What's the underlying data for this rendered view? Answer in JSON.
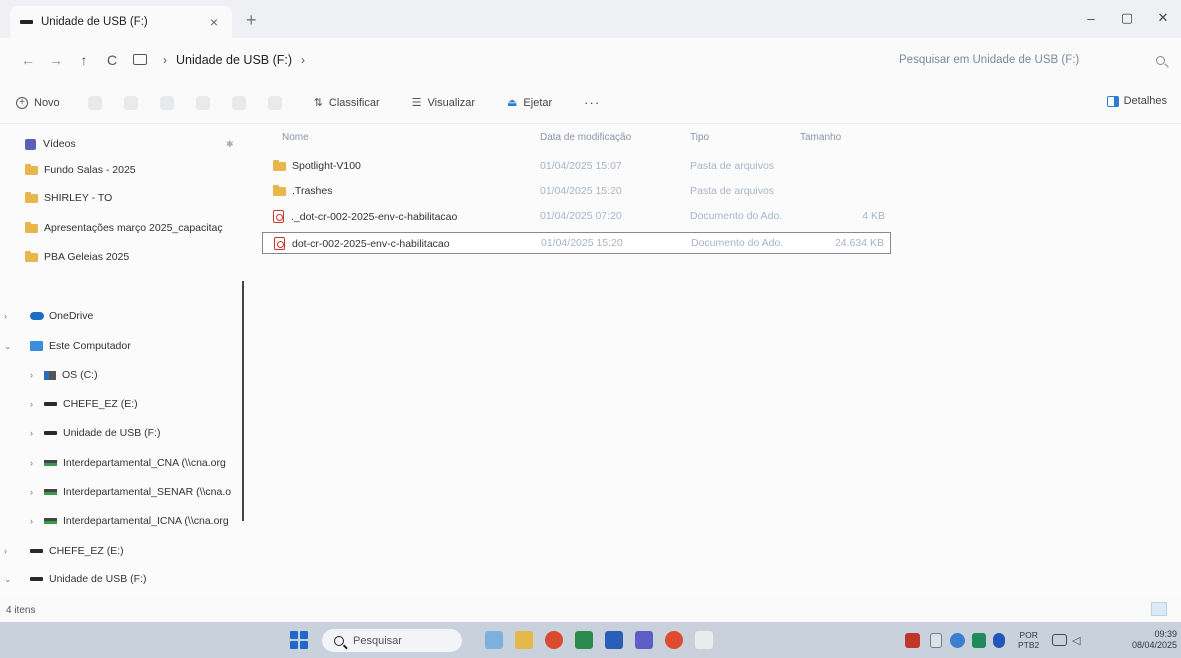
{
  "window": {
    "tab_title": "Unidade de USB (F:)",
    "tab_close": "×",
    "new_tab": "+",
    "controls": {
      "minimize": "–",
      "maximize": "▢",
      "close": "✕"
    }
  },
  "address": {
    "back": "←",
    "forward": "→",
    "up": "↑",
    "refresh": "C",
    "separator": "›",
    "crumb": "Unidade de USB (F:)",
    "search_placeholder": "Pesquisar em Unidade de USB (F:)"
  },
  "commands": {
    "new": "Novo",
    "sort": "Classificar",
    "view": "Visualizar",
    "eject": "Ejetar",
    "more": "···",
    "details": "Detalhes"
  },
  "sidebar": {
    "quick_access": [
      {
        "label": "Vídeos",
        "icon": "video-icon",
        "pinned": true
      },
      {
        "label": "Fundo Salas - 2025",
        "icon": "folder-icon"
      },
      {
        "label": "SHIRLEY - TO",
        "icon": "folder-icon"
      },
      {
        "label": "Apresentações março 2025_capacitaç",
        "icon": "folder-icon"
      },
      {
        "label": "PBA Geleias 2025",
        "icon": "folder-icon"
      }
    ],
    "tree": [
      {
        "label": "OneDrive",
        "icon": "cloud-icon",
        "chevron": "›"
      },
      {
        "label": "Este Computador",
        "icon": "computer-icon",
        "chevron": "⌄"
      },
      {
        "label": "OS (C:)",
        "icon": "os-drive-icon",
        "chevron": "›"
      },
      {
        "label": "CHEFE_EZ (E:)",
        "icon": "usb-drive-icon",
        "chevron": "›"
      },
      {
        "label": "Unidade de USB (F:)",
        "icon": "usb-drive-icon",
        "chevron": "›"
      },
      {
        "label": "Interdepartamental_CNA (\\\\cna.org",
        "icon": "network-drive-icon",
        "chevron": "›"
      },
      {
        "label": "Interdepartamental_SENAR (\\\\cna.o",
        "icon": "network-drive-icon",
        "chevron": "›"
      },
      {
        "label": "Interdepartamental_ICNA (\\\\cna.org",
        "icon": "network-drive-icon",
        "chevron": "›"
      },
      {
        "label": "CHEFE_EZ (E:)",
        "icon": "usb-drive-icon",
        "chevron": "›"
      },
      {
        "label": "Unidade de USB (F:)",
        "icon": "usb-drive-icon",
        "chevron": "⌄"
      }
    ]
  },
  "files": {
    "columns": {
      "name": "Nome",
      "date": "Data de modificação",
      "type": "Tipo",
      "size": "Tamanho"
    },
    "rows": [
      {
        "name": "Spotlight-V100",
        "date": "01/04/2025 15:07",
        "type": "Pasta de arquivos",
        "size": "",
        "icon": "folder-icon"
      },
      {
        "name": ".Trashes",
        "date": "01/04/2025 15:20",
        "type": "Pasta de arquivos",
        "size": "",
        "icon": "folder-icon"
      },
      {
        "name": "._dot-cr-002-2025-env-c-habilitacao",
        "date": "01/04/2025 07:20",
        "type": "Documento do Ado...",
        "size": "4 KB",
        "icon": "pdf-icon"
      },
      {
        "name": "dot-cr-002-2025-env-c-habilitacao",
        "date": "01/04/2025 15:20",
        "type": "Documento do Ado...",
        "size": "24.634 KB",
        "icon": "pdf-icon",
        "selected": true
      }
    ]
  },
  "status": {
    "count": "4 itens"
  },
  "taskbar": {
    "search_label": "Pesquisar",
    "lang_top": "POR",
    "lang_bottom": "PTB2",
    "time": "09:39",
    "date": "08/04/2025"
  }
}
